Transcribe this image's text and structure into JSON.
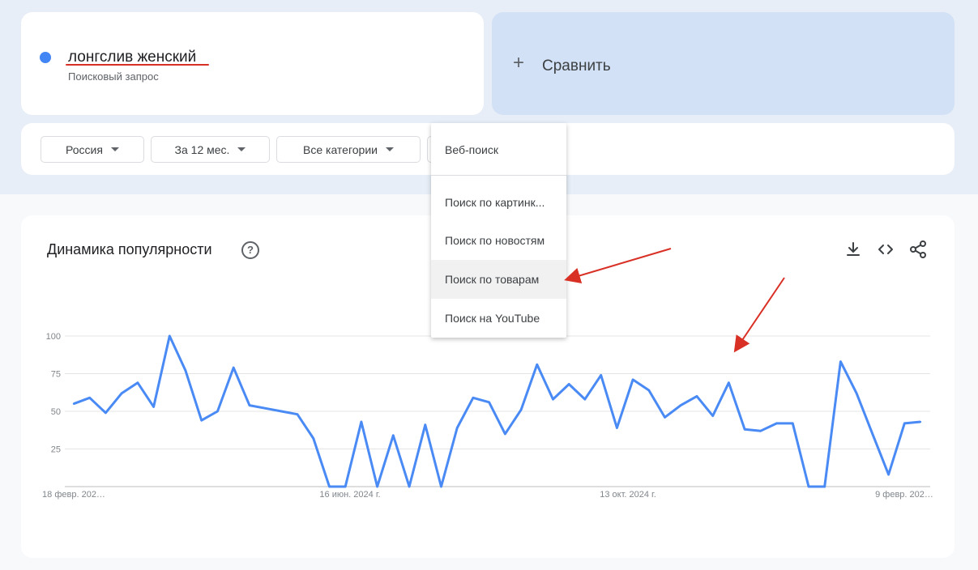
{
  "search_term": {
    "label": "лонгслив женский",
    "subtitle": "Поисковый запрос",
    "color": "#4285f4"
  },
  "compare": {
    "label": "Сравнить",
    "icon": "plus-icon"
  },
  "filters": {
    "region": "Россия",
    "period": "За 12 мес.",
    "category": "Все категории"
  },
  "search_type_menu": {
    "selected": "Веб-поиск",
    "items": [
      "Поиск по картинк...",
      "Поиск по новостям",
      "Поиск по товарам",
      "Поиск на YouTube"
    ],
    "highlighted": "Поиск по товарам"
  },
  "chart_panel": {
    "title": "Динамика популярности",
    "icons": [
      "help-icon",
      "download-icon",
      "embed-icon",
      "share-icon"
    ]
  },
  "annotation_color": "#d93025",
  "chart_data": {
    "type": "line",
    "title": "Динамика популярности",
    "ylim": [
      0,
      100
    ],
    "yticks": [
      25,
      50,
      75,
      100
    ],
    "x_tick_labels": [
      "18 февр. 202…",
      "16 июн. 2024 г.",
      "13 окт. 2024 г.",
      "9 февр. 202…"
    ],
    "x_tick_indices": [
      0,
      17,
      34,
      52
    ],
    "grid": true,
    "line_color": "#4a8af4",
    "series": [
      {
        "values": [
          55,
          59,
          49,
          62,
          69,
          53,
          100,
          77,
          44,
          50,
          79,
          54,
          52,
          50,
          48,
          32,
          0,
          0,
          43,
          0,
          34,
          0,
          41,
          0,
          39,
          59,
          56,
          35,
          51,
          81,
          58,
          68,
          58,
          74,
          39,
          71,
          64,
          46,
          54,
          60,
          47,
          69,
          38,
          37,
          42,
          42,
          0,
          0,
          83,
          62,
          35,
          8,
          42,
          43
        ]
      }
    ]
  }
}
